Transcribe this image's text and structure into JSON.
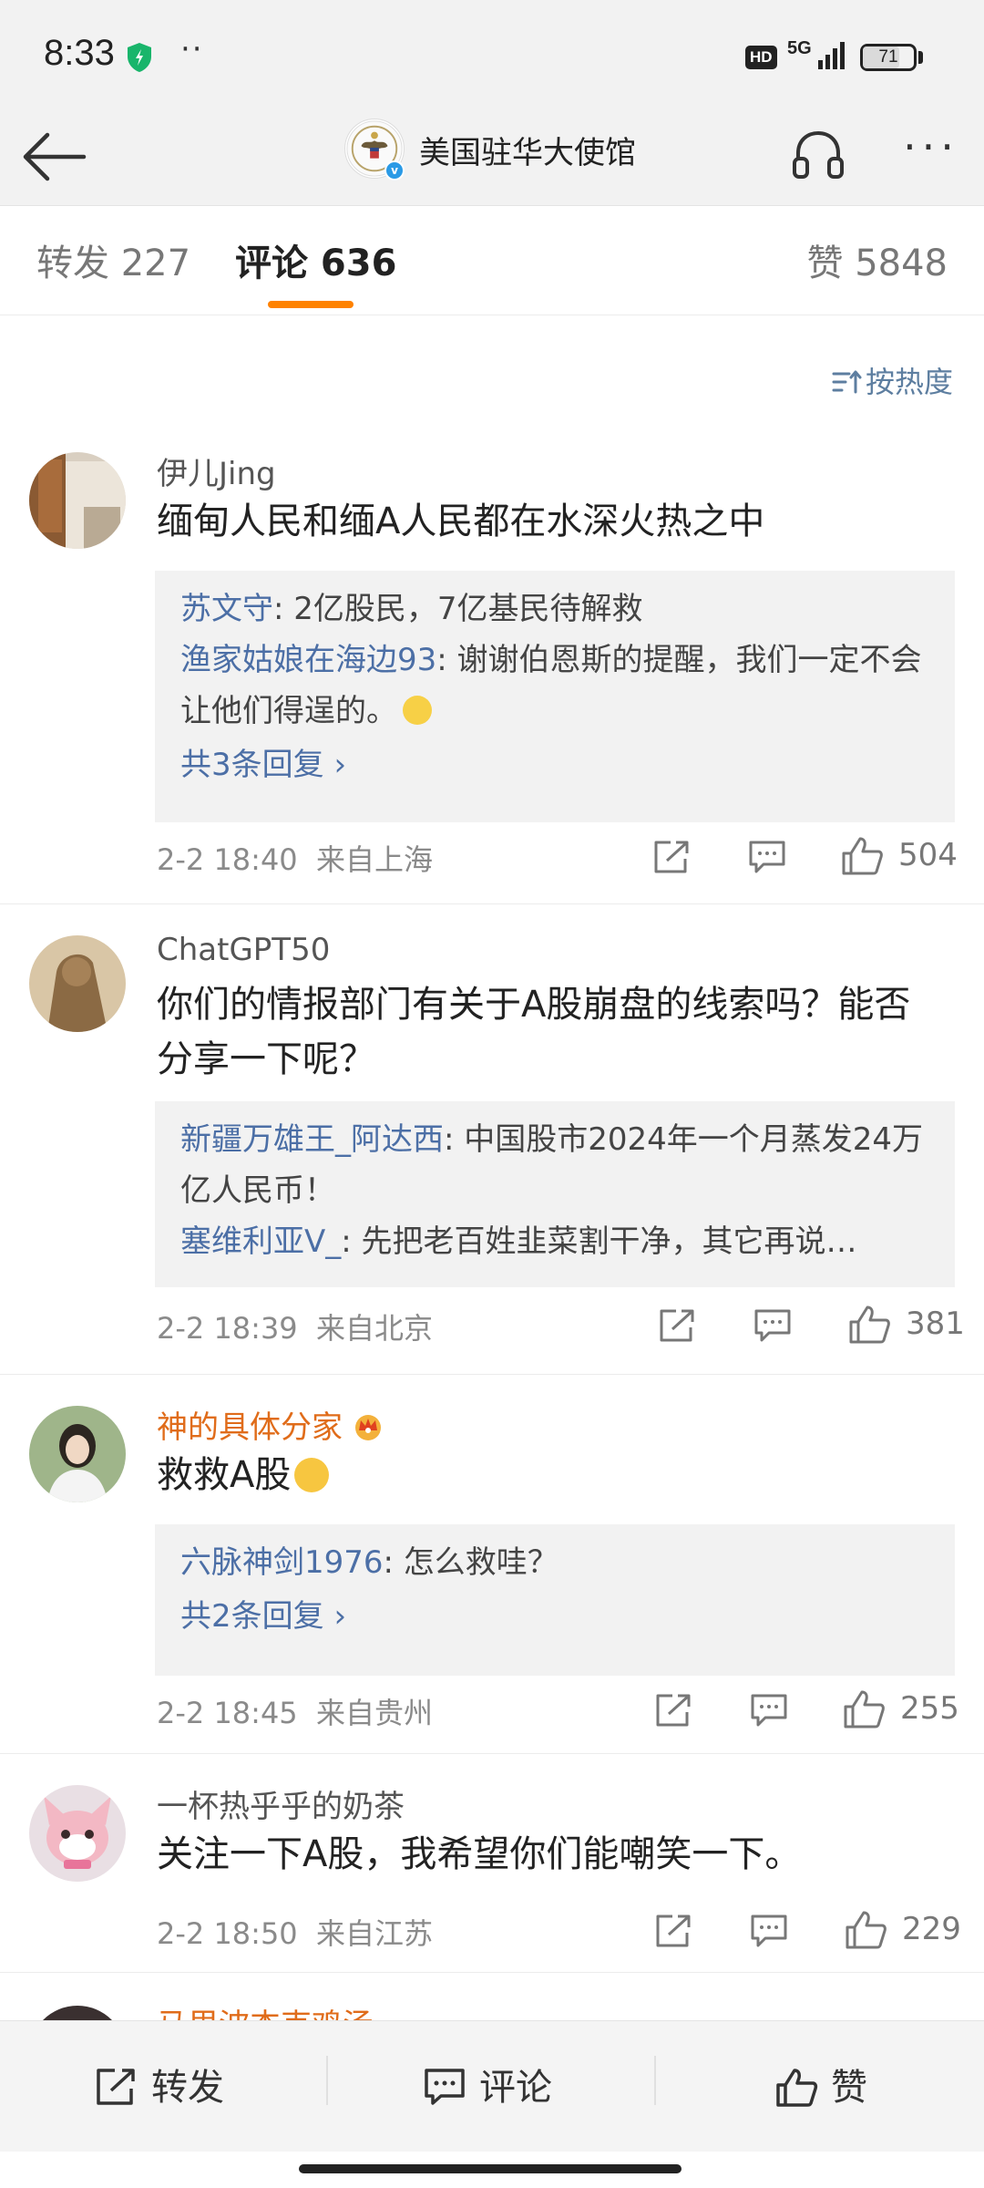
{
  "status": {
    "time": "8:33",
    "dots": "··",
    "hd": "HD",
    "network": "5G",
    "battery": "71",
    "battery_level": 0.71
  },
  "nav": {
    "title": "美国驻华大使馆"
  },
  "tabs": {
    "repost": "转发 227",
    "comment": "评论 636",
    "like": "赞 5848"
  },
  "sort_label": "按热度",
  "comments": [
    {
      "user": "伊儿Jing",
      "text": "缅甸人民和缅A人民都在水深火热之中",
      "replies": [
        {
          "user": "苏文守",
          "text": ": 2亿股民，7亿基民待解救"
        },
        {
          "user": "渔家姑娘在海边93",
          "text": ": 谢谢伯恩斯的提醒，我们一定不会让他们得逞的。"
        }
      ],
      "total_replies": "共3条回复 ›",
      "date": "2-2 18:40",
      "location": "来自上海",
      "likes": "504"
    },
    {
      "user": "ChatGPT50",
      "text": "你们的情报部门有关于A股崩盘的线索吗？能否分享一下呢？",
      "replies": [
        {
          "user": "新疆万雄王_阿达西",
          "text": ": 中国股市2024年一个月蒸发24万亿人民币！"
        },
        {
          "user": "塞维利亚V_",
          "text": ": 先把老百姓韭菜割干净，其它再说…"
        }
      ],
      "date": "2-2 18:39",
      "location": "来自北京",
      "likes": "381"
    },
    {
      "user": "神的具体分家",
      "text": "救救A股",
      "replies": [
        {
          "user": "六脉神剑1976",
          "text": ": 怎么救哇？"
        }
      ],
      "total_replies": "共2条回复 ›",
      "date": "2-2 18:45",
      "location": "来自贵州",
      "likes": "255"
    },
    {
      "user": "一杯热乎乎的奶茶",
      "text": "关注一下A股，我希望你们能嘲笑一下。",
      "date": "2-2 18:50",
      "location": "来自江苏",
      "likes": "229"
    }
  ],
  "partial_user": "马里波杰克鸡汤",
  "bottom": {
    "repost": "转发",
    "comment": "评论",
    "like": "赞"
  }
}
